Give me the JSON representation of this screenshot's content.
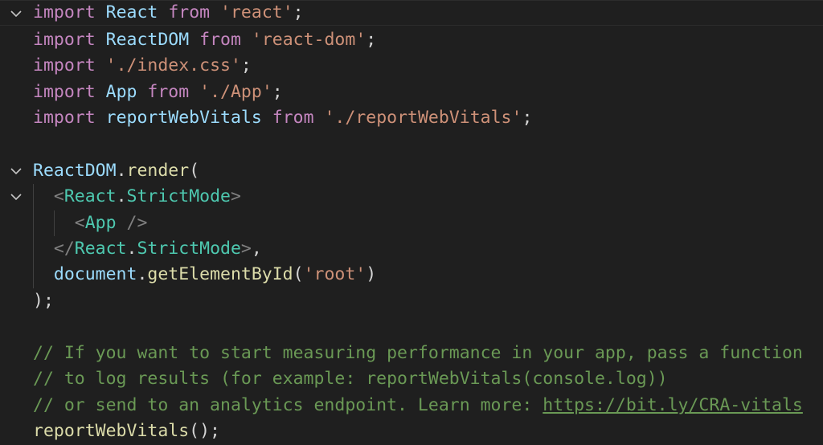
{
  "editor": {
    "lines": [
      {
        "tokens": [
          [
            "import",
            "kw"
          ],
          [
            " ",
            ""
          ],
          [
            "React",
            "id"
          ],
          [
            " ",
            ""
          ],
          [
            "from",
            "kw"
          ],
          [
            " ",
            ""
          ],
          [
            "'react'",
            "str"
          ],
          [
            ";",
            "pun"
          ]
        ]
      },
      {
        "tokens": [
          [
            "import",
            "kw"
          ],
          [
            " ",
            ""
          ],
          [
            "ReactDOM",
            "id"
          ],
          [
            " ",
            ""
          ],
          [
            "from",
            "kw"
          ],
          [
            " ",
            ""
          ],
          [
            "'react-dom'",
            "str"
          ],
          [
            ";",
            "pun"
          ]
        ]
      },
      {
        "tokens": [
          [
            "import",
            "kw"
          ],
          [
            " ",
            ""
          ],
          [
            "'./index.css'",
            "str"
          ],
          [
            ";",
            "pun"
          ]
        ]
      },
      {
        "tokens": [
          [
            "import",
            "kw"
          ],
          [
            " ",
            ""
          ],
          [
            "App",
            "id"
          ],
          [
            " ",
            ""
          ],
          [
            "from",
            "kw"
          ],
          [
            " ",
            ""
          ],
          [
            "'./App'",
            "str"
          ],
          [
            ";",
            "pun"
          ]
        ]
      },
      {
        "tokens": [
          [
            "import",
            "kw"
          ],
          [
            " ",
            ""
          ],
          [
            "reportWebVitals",
            "id"
          ],
          [
            " ",
            ""
          ],
          [
            "from",
            "kw"
          ],
          [
            " ",
            ""
          ],
          [
            "'./reportWebVitals'",
            "str"
          ],
          [
            ";",
            "pun"
          ]
        ]
      },
      {
        "tokens": []
      },
      {
        "tokens": [
          [
            "ReactDOM",
            "id"
          ],
          [
            ".",
            "pun"
          ],
          [
            "render",
            "fn"
          ],
          [
            "(",
            "pun"
          ]
        ]
      },
      {
        "tokens": [
          [
            "  ",
            ""
          ],
          [
            "<",
            "tagp"
          ],
          [
            "React",
            "ty"
          ],
          [
            ".",
            "pun"
          ],
          [
            "StrictMode",
            "ty"
          ],
          [
            ">",
            "tagp"
          ]
        ]
      },
      {
        "tokens": [
          [
            "    ",
            ""
          ],
          [
            "<",
            "tagp"
          ],
          [
            "App",
            "ty"
          ],
          [
            " />",
            "tagp"
          ]
        ]
      },
      {
        "tokens": [
          [
            "  ",
            ""
          ],
          [
            "</",
            "tagp"
          ],
          [
            "React",
            "ty"
          ],
          [
            ".",
            "pun"
          ],
          [
            "StrictMode",
            "ty"
          ],
          [
            ">",
            "tagp"
          ],
          [
            ",",
            "pun"
          ]
        ]
      },
      {
        "tokens": [
          [
            "  ",
            ""
          ],
          [
            "document",
            "id"
          ],
          [
            ".",
            "pun"
          ],
          [
            "getElementById",
            "fn"
          ],
          [
            "(",
            "pun"
          ],
          [
            "'root'",
            "str"
          ],
          [
            ")",
            "pun"
          ]
        ]
      },
      {
        "tokens": [
          [
            ");",
            "pun"
          ]
        ]
      },
      {
        "tokens": []
      },
      {
        "tokens": [
          [
            "// If you want to start measuring performance in your app, pass a function",
            "cmt"
          ]
        ]
      },
      {
        "tokens": [
          [
            "// to log results (for example: reportWebVitals(console.log))",
            "cmt"
          ]
        ]
      },
      {
        "tokens": [
          [
            "// or send to an analytics endpoint. Learn more: ",
            "cmt"
          ],
          [
            "https://bit.ly/CRA-vitals",
            "link"
          ]
        ]
      },
      {
        "tokens": [
          [
            "reportWebVitals",
            "fn"
          ],
          [
            "();",
            "pun"
          ]
        ]
      }
    ],
    "fold_icons": [
      "chevron-down-icon",
      "chevron-down-icon",
      "chevron-down-icon"
    ]
  }
}
